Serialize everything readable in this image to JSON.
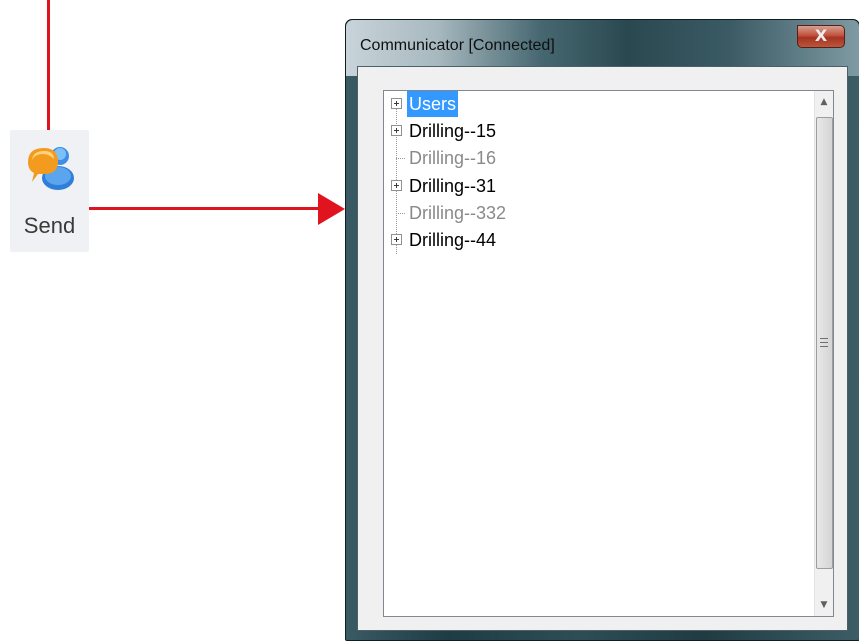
{
  "send_button": {
    "label": "Send",
    "icon": "chat-bubbles-icon"
  },
  "window": {
    "title": "Communicator [Connected]",
    "close_label": "X"
  },
  "tree": {
    "items": [
      {
        "label": "Users",
        "expandable": true,
        "selected": true,
        "grayed": false
      },
      {
        "label": "Drilling--15",
        "expandable": true,
        "selected": false,
        "grayed": false
      },
      {
        "label": "Drilling--16",
        "expandable": false,
        "selected": false,
        "grayed": true
      },
      {
        "label": "Drilling--31",
        "expandable": true,
        "selected": false,
        "grayed": false
      },
      {
        "label": "Drilling--332",
        "expandable": false,
        "selected": false,
        "grayed": true
      },
      {
        "label": "Drilling--44",
        "expandable": true,
        "selected": false,
        "grayed": false
      }
    ]
  },
  "scrollbar": {
    "up_icon": "scroll-up-arrow-icon",
    "down_icon": "scroll-down-arrow-icon",
    "grip_icon": "scroll-grip-icon"
  },
  "colors": {
    "annotation_red": "#e0141e",
    "selection_blue": "#3399ff",
    "close_red": "#c8422c"
  }
}
